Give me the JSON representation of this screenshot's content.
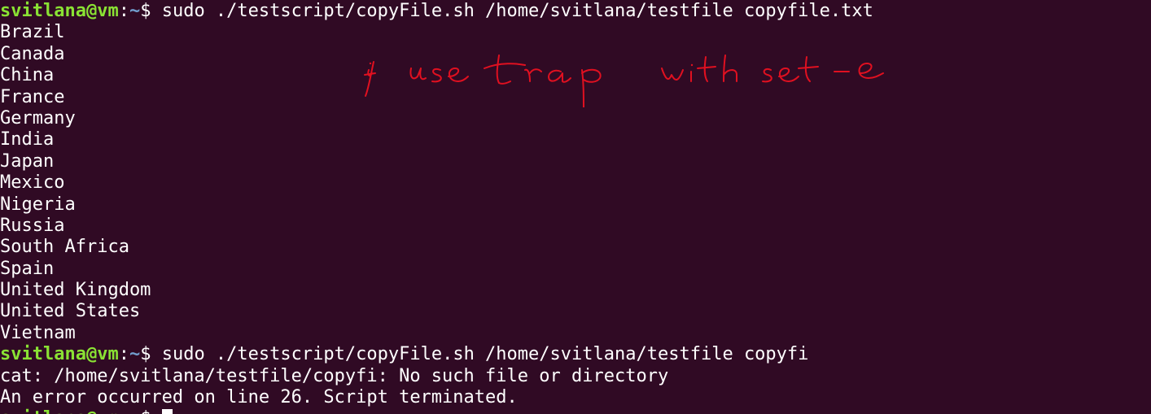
{
  "prompt": {
    "user_host": "svitlana@vm",
    "separator": ":",
    "path": "~",
    "symbol": "$ "
  },
  "command1": "sudo ./testscript/copyFile.sh /home/svitlana/testfile copyfile.txt",
  "countries": [
    "Brazil",
    "Canada",
    "China",
    "France",
    "Germany",
    "India",
    "Japan",
    "Mexico",
    "Nigeria",
    "Russia",
    "South Africa",
    "Spain",
    "United Kingdom",
    "United States",
    "Vietnam"
  ],
  "command2": "sudo ./testscript/copyFile.sh /home/svitlana/testfile copyfi",
  "error_line": "cat: /home/svitlana/testfile/copyfi: No such file or directory",
  "message_line": "An error occurred on line 26. Script terminated.",
  "annotation": "if use trap with set -e"
}
